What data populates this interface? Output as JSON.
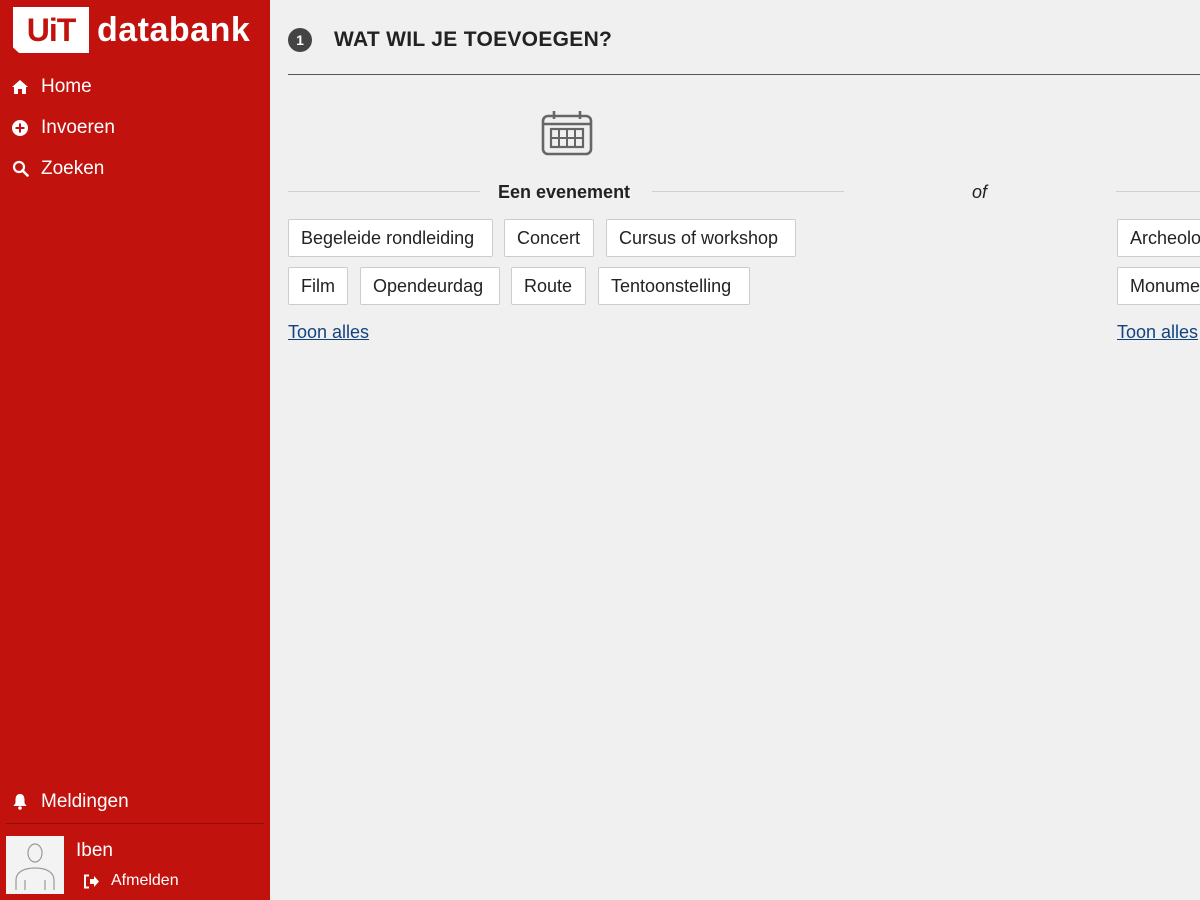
{
  "brand": {
    "logo_box": "UiT",
    "logo_word": "databank"
  },
  "nav": {
    "items": [
      {
        "label": "Home",
        "icon": "home-icon"
      },
      {
        "label": "Invoeren",
        "icon": "plus-circle-icon"
      },
      {
        "label": "Zoeken",
        "icon": "search-icon"
      }
    ],
    "notifications": {
      "label": "Meldingen",
      "icon": "bell-icon"
    }
  },
  "user": {
    "name": "Iben",
    "logout_label": "Afmelden"
  },
  "step": {
    "number": "1",
    "title": "WAT WIL JE TOEVOEGEN?"
  },
  "event_section": {
    "title": "Een evenement",
    "icon": "calendar-icon",
    "chips": [
      "Begeleide rondleiding",
      "Concert",
      "Cursus of workshop",
      "Film",
      "Opendeurdag",
      "Route",
      "Tentoonstelling"
    ],
    "show_all": "Toon alles"
  },
  "separator": "of",
  "place_section": {
    "chips": [
      "Archeolo",
      "Monume"
    ],
    "show_all": "Toon alles"
  },
  "colors": {
    "sidebar": "#c1120e",
    "background": "#f0f0f0",
    "link": "#12437f"
  }
}
